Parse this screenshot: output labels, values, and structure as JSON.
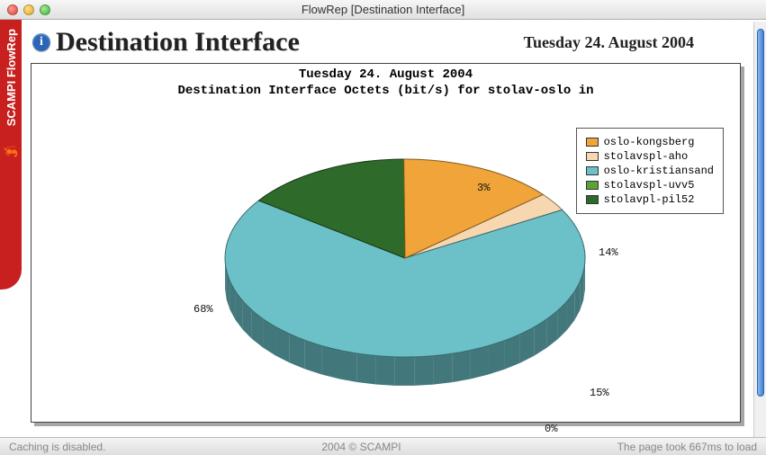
{
  "window": {
    "title": "FlowRep [Destination Interface]"
  },
  "sidebar": {
    "label": "SCAMPI FlowRep"
  },
  "header": {
    "title": "Destination Interface",
    "date": "Tuesday 24. August 2004"
  },
  "chart": {
    "title_line1": "Tuesday 24. August 2004",
    "title_line2": "Destination Interface Octets (bit/s) for stolav-oslo in"
  },
  "chart_data": {
    "type": "pie",
    "title": "Destination Interface Octets (bit/s) for stolav-oslo in",
    "subtitle": "Tuesday 24. August 2004",
    "series": [
      {
        "name": "oslo-kongsberg",
        "value": 14,
        "label": "14%",
        "color": "#f0a43a"
      },
      {
        "name": "stolavspl-aho",
        "value": 3,
        "label": "3%",
        "color": "#f7d7b0"
      },
      {
        "name": "oslo-kristiansand",
        "value": 68,
        "label": "68%",
        "color": "#6bc1c7"
      },
      {
        "name": "stolavspl-uvv5",
        "value": 0,
        "label": "0%",
        "color": "#5aa339"
      },
      {
        "name": "stolavpl-pil52",
        "value": 15,
        "label": "15%",
        "color": "#2e6a2a"
      }
    ],
    "legend_position": "right"
  },
  "status": {
    "left": "Caching is disabled.",
    "center": "2004 © SCAMPI",
    "right": "The page took 667ms to load"
  }
}
